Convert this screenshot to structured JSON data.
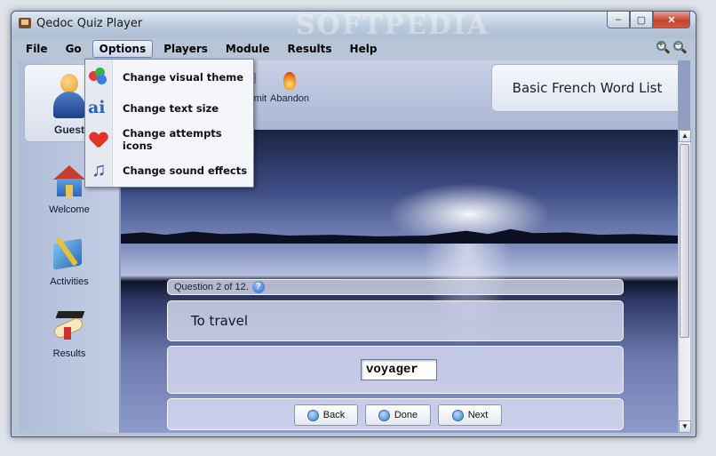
{
  "window": {
    "title": "Qedoc Quiz Player",
    "watermark": "SOFTPEDIA"
  },
  "titlebar_buttons": [
    "–",
    "▢",
    "✕"
  ],
  "menu": [
    "File",
    "Go",
    "Options",
    "Players",
    "Module",
    "Results",
    "Help"
  ],
  "options_menu": [
    {
      "label": "Change visual theme",
      "icon": "palette-icon"
    },
    {
      "label": "Change text size",
      "icon": "text-size-icon"
    },
    {
      "label": "Change attempts icons",
      "icon": "heart-icon"
    },
    {
      "label": "Change sound effects",
      "icon": "music-note-icon"
    }
  ],
  "sidebar": {
    "user": "Guest",
    "items": [
      {
        "label": "Welcome",
        "icon": "house-icon"
      },
      {
        "label": "Activities",
        "icon": "pencil-book-icon"
      },
      {
        "label": "Results",
        "icon": "graduation-icon"
      }
    ]
  },
  "toolbar": {
    "submit": "Submit",
    "abandon": "Abandon"
  },
  "module_title": "Basic French Word List",
  "quiz": {
    "progress": "Question 2 of 12.",
    "help_glyph": "?",
    "question": "To travel",
    "answer": "voyager"
  },
  "nav": {
    "back": "Back",
    "done": "Done",
    "next": "Next"
  },
  "scroll": {
    "up": "▲",
    "down": "▼"
  },
  "zoom": {
    "in": "+",
    "out": "−"
  }
}
